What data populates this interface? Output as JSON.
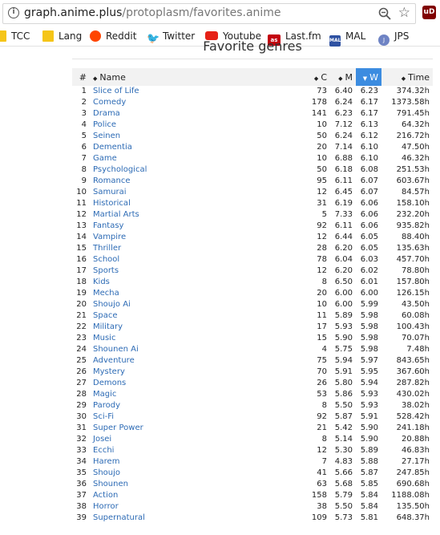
{
  "browser": {
    "url_domain": "graph.anime.plus",
    "url_path": "/protoplasm/favorites.anime",
    "extension_label": "uD"
  },
  "bookmarks": [
    {
      "label": "TCC",
      "icon": "folder-icon"
    },
    {
      "label": "Lang",
      "icon": "folder-icon"
    },
    {
      "label": "Reddit",
      "icon": "reddit-icon"
    },
    {
      "label": "Twitter",
      "icon": "twitter-icon"
    },
    {
      "label": "Youtube",
      "icon": "youtube-icon"
    },
    {
      "label": "Last.fm",
      "icon": "lastfm-icon"
    },
    {
      "label": "MAL",
      "icon": "mal-icon"
    },
    {
      "label": "JPS",
      "icon": "jps-icon"
    }
  ],
  "page": {
    "title": "Favorite genres"
  },
  "table": {
    "headers": {
      "num": "#",
      "name": "Name",
      "c": "C",
      "m": "M",
      "w": "W",
      "time": "Time"
    },
    "sorted_column": "W",
    "rows": [
      [
        "1",
        "Slice of Life",
        "73",
        "6.40",
        "6.23",
        "374.32h"
      ],
      [
        "2",
        "Comedy",
        "178",
        "6.24",
        "6.17",
        "1373.58h"
      ],
      [
        "3",
        "Drama",
        "141",
        "6.23",
        "6.17",
        "791.45h"
      ],
      [
        "4",
        "Police",
        "10",
        "7.12",
        "6.13",
        "64.32h"
      ],
      [
        "5",
        "Seinen",
        "50",
        "6.24",
        "6.12",
        "216.72h"
      ],
      [
        "6",
        "Dementia",
        "20",
        "7.14",
        "6.10",
        "47.50h"
      ],
      [
        "7",
        "Game",
        "10",
        "6.88",
        "6.10",
        "46.32h"
      ],
      [
        "8",
        "Psychological",
        "50",
        "6.18",
        "6.08",
        "251.53h"
      ],
      [
        "9",
        "Romance",
        "95",
        "6.11",
        "6.07",
        "603.67h"
      ],
      [
        "10",
        "Samurai",
        "12",
        "6.45",
        "6.07",
        "84.57h"
      ],
      [
        "11",
        "Historical",
        "31",
        "6.19",
        "6.06",
        "158.10h"
      ],
      [
        "12",
        "Martial Arts",
        "5",
        "7.33",
        "6.06",
        "232.20h"
      ],
      [
        "13",
        "Fantasy",
        "92",
        "6.11",
        "6.06",
        "935.82h"
      ],
      [
        "14",
        "Vampire",
        "12",
        "6.44",
        "6.05",
        "88.40h"
      ],
      [
        "15",
        "Thriller",
        "28",
        "6.20",
        "6.05",
        "135.63h"
      ],
      [
        "16",
        "School",
        "78",
        "6.04",
        "6.03",
        "457.70h"
      ],
      [
        "17",
        "Sports",
        "12",
        "6.20",
        "6.02",
        "78.80h"
      ],
      [
        "18",
        "Kids",
        "8",
        "6.50",
        "6.01",
        "157.80h"
      ],
      [
        "19",
        "Mecha",
        "20",
        "6.00",
        "6.00",
        "126.15h"
      ],
      [
        "20",
        "Shoujo Ai",
        "10",
        "6.00",
        "5.99",
        "43.50h"
      ],
      [
        "21",
        "Space",
        "11",
        "5.89",
        "5.98",
        "60.08h"
      ],
      [
        "22",
        "Military",
        "17",
        "5.93",
        "5.98",
        "100.43h"
      ],
      [
        "23",
        "Music",
        "15",
        "5.90",
        "5.98",
        "70.07h"
      ],
      [
        "24",
        "Shounen Ai",
        "4",
        "5.75",
        "5.98",
        "7.48h"
      ],
      [
        "25",
        "Adventure",
        "75",
        "5.94",
        "5.97",
        "843.65h"
      ],
      [
        "26",
        "Mystery",
        "70",
        "5.91",
        "5.95",
        "367.60h"
      ],
      [
        "27",
        "Demons",
        "26",
        "5.80",
        "5.94",
        "287.82h"
      ],
      [
        "28",
        "Magic",
        "53",
        "5.86",
        "5.93",
        "430.02h"
      ],
      [
        "29",
        "Parody",
        "8",
        "5.50",
        "5.93",
        "38.02h"
      ],
      [
        "30",
        "Sci-Fi",
        "92",
        "5.87",
        "5.91",
        "528.42h"
      ],
      [
        "31",
        "Super Power",
        "21",
        "5.42",
        "5.90",
        "241.18h"
      ],
      [
        "32",
        "Josei",
        "8",
        "5.14",
        "5.90",
        "20.88h"
      ],
      [
        "33",
        "Ecchi",
        "12",
        "5.30",
        "5.89",
        "46.83h"
      ],
      [
        "34",
        "Harem",
        "7",
        "4.83",
        "5.88",
        "27.17h"
      ],
      [
        "35",
        "Shoujo",
        "41",
        "5.66",
        "5.87",
        "247.85h"
      ],
      [
        "36",
        "Shounen",
        "63",
        "5.68",
        "5.85",
        "690.68h"
      ],
      [
        "37",
        "Action",
        "158",
        "5.79",
        "5.84",
        "1188.08h"
      ],
      [
        "38",
        "Horror",
        "38",
        "5.50",
        "5.84",
        "135.50h"
      ],
      [
        "39",
        "Supernatural",
        "109",
        "5.73",
        "5.81",
        "648.37h"
      ]
    ]
  }
}
